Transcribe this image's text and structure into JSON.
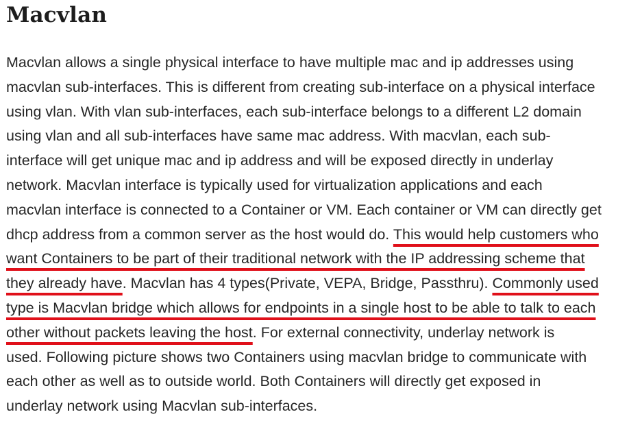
{
  "section": {
    "title": "Macvlan"
  },
  "paragraph": {
    "line1": "Macvlan allows a single physical interface to have multiple mac and ip addresses using",
    "line2": "macvlan sub-interfaces. This is different from creating sub-interface on a physical interface",
    "line3": "using vlan. With vlan sub-interfaces, each sub-interface belongs to a different L2 domain",
    "line4": "using vlan and all sub-interfaces have same mac address. With macvlan, each sub-",
    "line5": "interface will get unique mac and ip address and will be exposed directly in underlay",
    "line6": "network. Macvlan interface is typically used for virtualization applications and each",
    "line7": "macvlan interface is connected to a Container or VM. Each container or VM can directly get",
    "line8_plain": "dhcp address from a common server as the host would do. ",
    "line8_highlight": "This would help customers who",
    "line9_highlight": "want Containers to be part of their traditional network with the IP addressing scheme that",
    "line10_highlight": "they already have",
    "line10_plain": ". Macvlan has 4 types(Private, VEPA, Bridge, Passthru). ",
    "line10_highlight2": "Commonly used",
    "line11_highlight": "type is Macvlan bridge which allows for endpoints in a single host to be able to talk to each",
    "line12_highlight": "other without packets leaving the host",
    "line12_plain": ". For external connectivity, underlay network is",
    "line13": "used. Following picture shows two Containers using macvlan bridge to communicate with",
    "line14": "each other as well as to outside world. Both Containers will directly get exposed in",
    "line15": "underlay network using Macvlan sub-interfaces."
  },
  "colors": {
    "underline": "#e0101a",
    "text": "#262626"
  }
}
